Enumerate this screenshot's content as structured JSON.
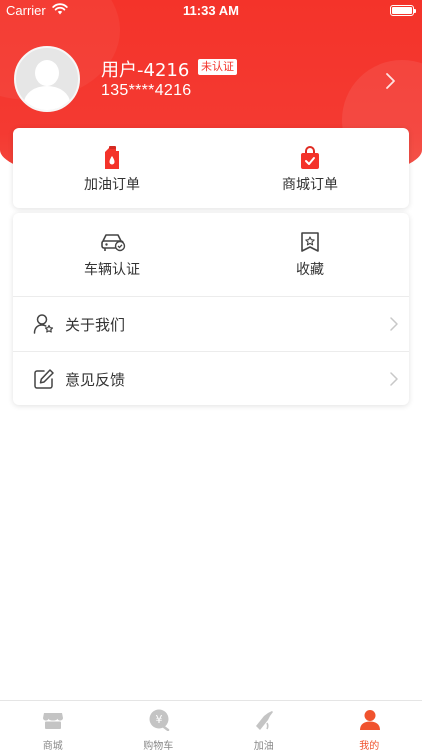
{
  "status_bar": {
    "carrier": "Carrier",
    "time": "11:33 AM"
  },
  "profile": {
    "username": "用户-4216",
    "verify_badge": "未认证",
    "phone": "135****4216"
  },
  "orders": {
    "fuel_orders": "加油订单",
    "mall_orders": "商城订单"
  },
  "tools": {
    "vehicle_verify": "车辆认证",
    "favorites": "收藏"
  },
  "menu": {
    "about_us": "关于我们",
    "feedback": "意见反馈"
  },
  "tab_bar": {
    "tabs": [
      {
        "label": "商城",
        "icon": "store-icon"
      },
      {
        "label": "购物车",
        "icon": "cart-icon"
      },
      {
        "label": "加油",
        "icon": "fuel-nozzle-icon"
      },
      {
        "label": "我的",
        "icon": "user-icon",
        "active": true
      }
    ]
  },
  "colors": {
    "brand_red": "#f4332a",
    "accent_orange": "#f0532e",
    "inactive_gray": "#888888"
  }
}
